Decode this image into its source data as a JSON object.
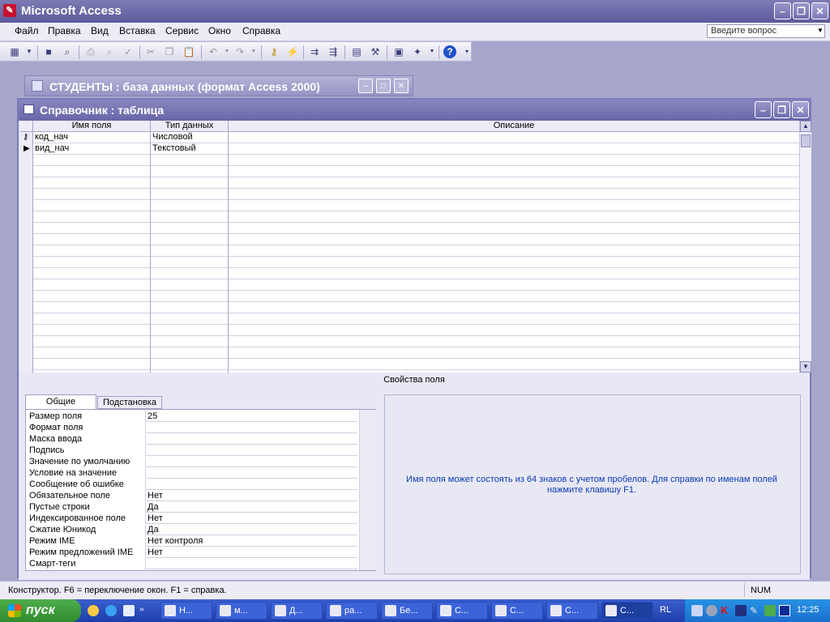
{
  "app": {
    "title": "Microsoft Access"
  },
  "menu": [
    "Файл",
    "Правка",
    "Вид",
    "Вставка",
    "Сервис",
    "Окно",
    "Справка"
  ],
  "ask_box": {
    "placeholder": "Введите вопрос"
  },
  "db_window": {
    "title": "СТУДЕНТЫ : база данных (формат Access 2000)"
  },
  "table_window": {
    "title": "Справочник : таблица"
  },
  "grid": {
    "headers": {
      "field_name": "Имя поля",
      "data_type": "Тип данных",
      "description": "Описание"
    },
    "rows": [
      {
        "name": "код_нач",
        "type": "Числовой",
        "description": ""
      },
      {
        "name": "вид_нач",
        "type": "Текстовый",
        "description": ""
      }
    ]
  },
  "properties": {
    "header": "Свойства поля",
    "tabs": [
      "Общие",
      "Подстановка"
    ],
    "items": [
      {
        "label": "Размер поля",
        "value": "25"
      },
      {
        "label": "Формат поля",
        "value": ""
      },
      {
        "label": "Маска ввода",
        "value": ""
      },
      {
        "label": "Подпись",
        "value": ""
      },
      {
        "label": "Значение по умолчанию",
        "value": ""
      },
      {
        "label": "Условие на значение",
        "value": ""
      },
      {
        "label": "Сообщение об ошибке",
        "value": ""
      },
      {
        "label": "Обязательное поле",
        "value": "Нет"
      },
      {
        "label": "Пустые строки",
        "value": "Да"
      },
      {
        "label": "Индексированное поле",
        "value": "Нет"
      },
      {
        "label": "Сжатие Юникод",
        "value": "Да"
      },
      {
        "label": "Режим IME",
        "value": "Нет контроля"
      },
      {
        "label": "Режим предложений IME",
        "value": "Нет"
      },
      {
        "label": "Смарт-теги",
        "value": ""
      }
    ],
    "help": "Имя поля может состоять из 64 знаков с учетом пробелов.  Для справки по именам полей нажмите клавишу F1."
  },
  "status": {
    "text": "Конструктор.  F6 = переключение окон.  F1 = справка.",
    "num": "NUM"
  },
  "taskbar": {
    "start": "пуск",
    "tasks": [
      "Н...",
      "м...",
      "Д...",
      "ра...",
      "Бе...",
      "С...",
      "С...",
      "С...",
      "С..."
    ],
    "lang": "RL",
    "clock": "12:25"
  }
}
